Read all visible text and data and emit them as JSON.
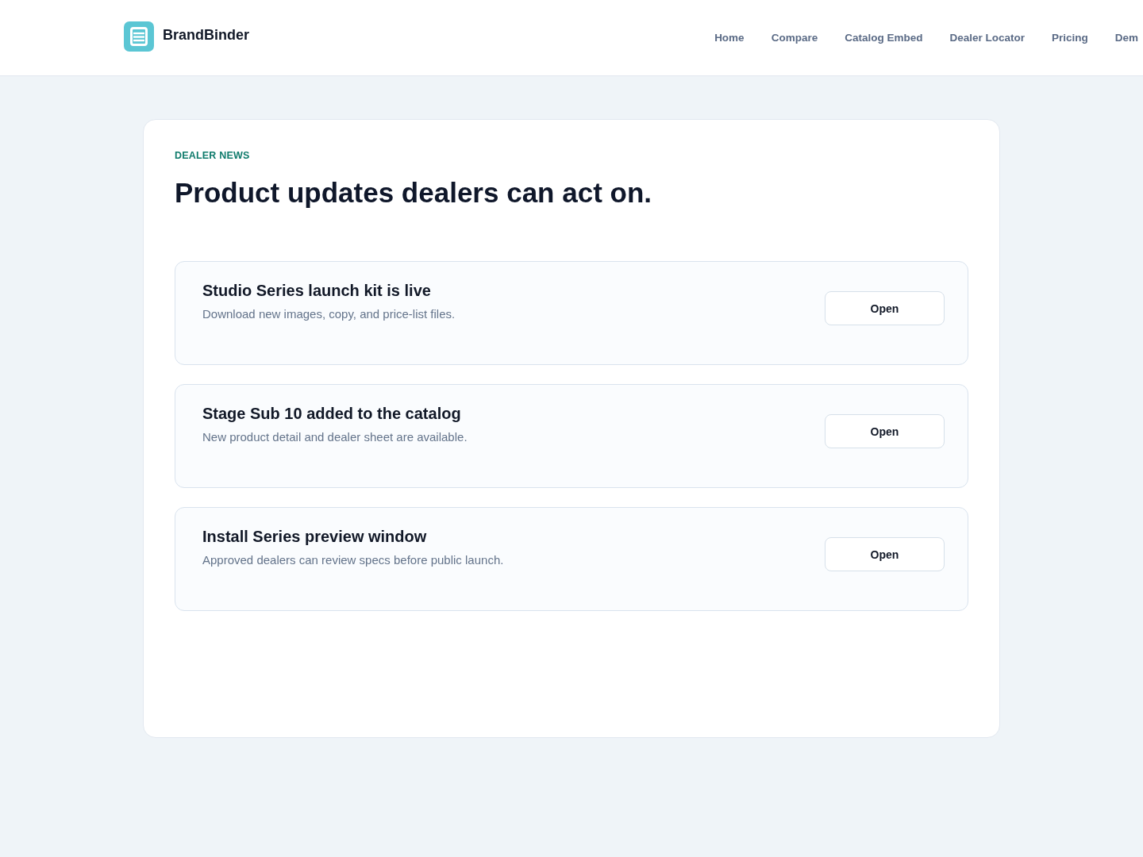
{
  "header": {
    "brand": "BrandBinder",
    "nav": [
      "Home",
      "Compare",
      "Catalog Embed",
      "Dealer Locator",
      "Pricing",
      "Dem"
    ]
  },
  "news": {
    "eyebrow": "DEALER NEWS",
    "title": "Product updates dealers can act on.",
    "items": [
      {
        "title": "Studio Series launch kit is live",
        "description": "Download new images, copy, and price-list files.",
        "action": "Open"
      },
      {
        "title": "Stage Sub 10 added to the catalog",
        "description": "New product detail and dealer sheet are available.",
        "action": "Open"
      },
      {
        "title": "Install Series preview window",
        "description": "Approved dealers can review specs before public launch.",
        "action": "Open"
      }
    ]
  }
}
